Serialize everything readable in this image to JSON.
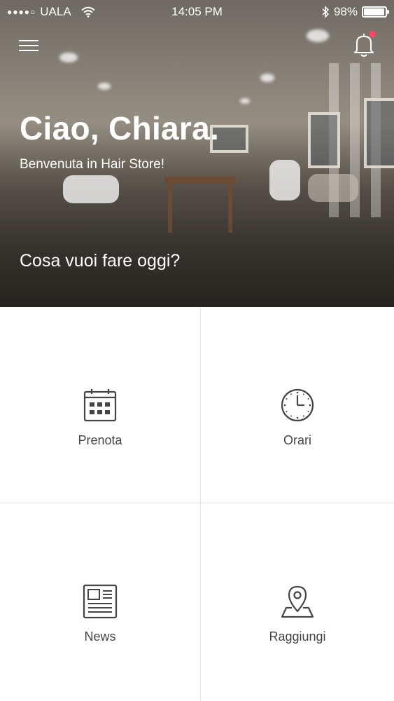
{
  "status_bar": {
    "signal_dots": "●●●●○",
    "carrier": "UALA",
    "time": "14:05 PM",
    "battery_percent": "98%",
    "battery_level": 0.98,
    "wifi_icon": "wifi-icon",
    "bluetooth_icon": "bluetooth-icon"
  },
  "header": {
    "menu_icon": "hamburger-menu-icon",
    "notification_icon": "bell-icon",
    "notification_dot_color": "#ef4b63"
  },
  "hero": {
    "greeting": "Ciao, Chiara.",
    "welcome": "Benvenuta in Hair Store!",
    "question": "Cosa vuoi fare oggi?"
  },
  "actions": [
    {
      "label": "Prenota",
      "icon": "calendar-icon"
    },
    {
      "label": "Orari",
      "icon": "clock-icon"
    },
    {
      "label": "News",
      "icon": "newspaper-icon"
    },
    {
      "label": "Raggiungi",
      "icon": "map-pin-icon"
    }
  ],
  "colors": {
    "icon_stroke": "#444444",
    "divider": "#e2e2e2",
    "text_on_image": "#ffffff"
  }
}
